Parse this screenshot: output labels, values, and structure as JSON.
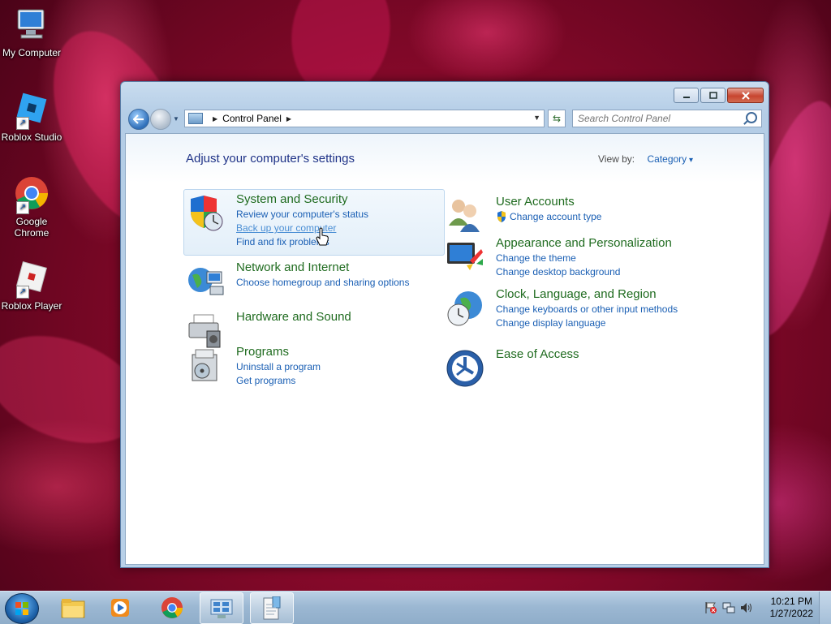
{
  "desktop": {
    "icons": [
      {
        "label": "My Computer"
      },
      {
        "label": "Roblox Studio"
      },
      {
        "label": "Google Chrome"
      },
      {
        "label": "Roblox Player"
      }
    ]
  },
  "window": {
    "address": {
      "crumb": "Control Panel"
    },
    "search": {
      "placeholder": "Search Control Panel"
    },
    "heading": "Adjust your computer's settings",
    "view_by": {
      "label": "View by:",
      "value": "Category"
    },
    "categories": [
      {
        "title": "System and Security",
        "links": [
          "Review your computer's status",
          "Back up your computer",
          "Find and fix problems"
        ]
      },
      {
        "title": "Network and Internet",
        "links": [
          "Choose homegroup and sharing options"
        ]
      },
      {
        "title": "Hardware and Sound",
        "links": []
      },
      {
        "title": "Programs",
        "links": [
          "Uninstall a program",
          "Get programs"
        ]
      },
      {
        "title": "User Accounts",
        "links": [
          "Change account type"
        ]
      },
      {
        "title": "Appearance and Personalization",
        "links": [
          "Change the theme",
          "Change desktop background"
        ]
      },
      {
        "title": "Clock, Language, and Region",
        "links": [
          "Change keyboards or other input methods",
          "Change display language"
        ]
      },
      {
        "title": "Ease of Access",
        "links": []
      }
    ]
  },
  "taskbar": {
    "clock": {
      "time": "10:21 PM",
      "date": "1/27/2022"
    }
  },
  "colors": {
    "category_title": "#1f6b1f",
    "link": "#1a5fb4",
    "heading": "#1e3287"
  }
}
